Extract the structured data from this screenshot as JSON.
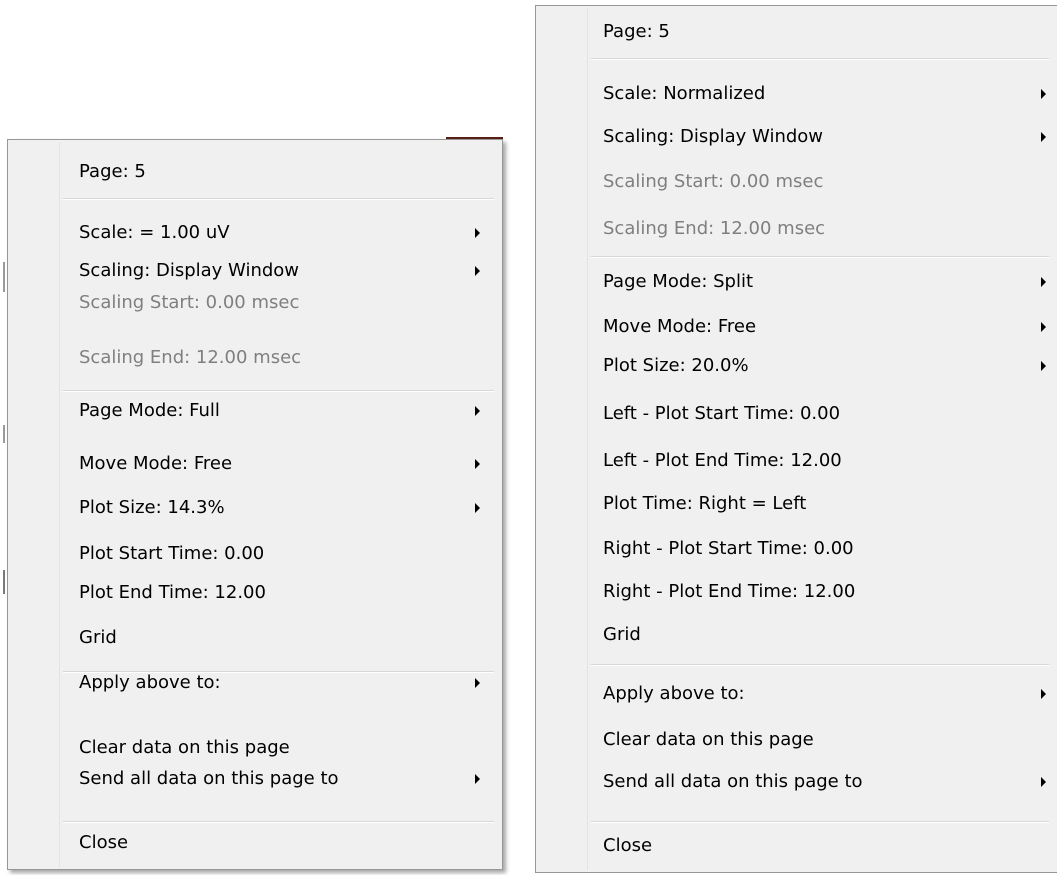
{
  "left_menu": {
    "items": [
      {
        "label": "Page: 5",
        "submenu": false,
        "disabled": false
      },
      {
        "label": "Scale: =  1.00 uV",
        "submenu": true,
        "disabled": false
      },
      {
        "label": "Scaling: Display Window",
        "submenu": true,
        "disabled": false
      },
      {
        "label": "Scaling Start:  0.00 msec",
        "submenu": false,
        "disabled": true
      },
      {
        "label": "Scaling End:  12.00 msec",
        "submenu": false,
        "disabled": true
      },
      {
        "label": "Page Mode: Full",
        "submenu": true,
        "disabled": false
      },
      {
        "label": "Move Mode: Free",
        "submenu": true,
        "disabled": false
      },
      {
        "label": "Plot Size: 14.3%",
        "submenu": true,
        "disabled": false
      },
      {
        "label": "Plot Start Time:  0.00",
        "submenu": false,
        "disabled": false
      },
      {
        "label": "Plot End Time: 12.00",
        "submenu": false,
        "disabled": false
      },
      {
        "label": "Grid",
        "submenu": false,
        "disabled": false
      },
      {
        "label": "Apply above to:",
        "submenu": true,
        "disabled": false
      },
      {
        "label": "Clear data on this page",
        "submenu": false,
        "disabled": false
      },
      {
        "label": "Send all data on this page to",
        "submenu": true,
        "disabled": false
      },
      {
        "label": "Close",
        "submenu": false,
        "disabled": false
      }
    ]
  },
  "right_menu": {
    "items": [
      {
        "label": "Page: 5",
        "submenu": false,
        "disabled": false
      },
      {
        "label": "Scale: Normalized",
        "submenu": true,
        "disabled": false
      },
      {
        "label": "Scaling: Display Window",
        "submenu": true,
        "disabled": false
      },
      {
        "label": "Scaling Start:  0.00 msec",
        "submenu": false,
        "disabled": true
      },
      {
        "label": "Scaling End:  12.00 msec",
        "submenu": false,
        "disabled": true
      },
      {
        "label": "Page Mode: Split",
        "submenu": true,
        "disabled": false
      },
      {
        "label": "Move Mode: Free",
        "submenu": true,
        "disabled": false
      },
      {
        "label": "Plot Size: 20.0%",
        "submenu": true,
        "disabled": false
      },
      {
        "label": "Left - Plot Start Time:  0.00",
        "submenu": false,
        "disabled": false
      },
      {
        "label": "Left - Plot End Time: 12.00",
        "submenu": false,
        "disabled": false
      },
      {
        "label": "Plot Time: Right = Left",
        "submenu": false,
        "disabled": false
      },
      {
        "label": "Right - Plot Start Time:  0.00",
        "submenu": false,
        "disabled": false
      },
      {
        "label": "Right - Plot End Time: 12.00",
        "submenu": false,
        "disabled": false
      },
      {
        "label": "Grid",
        "submenu": false,
        "disabled": false
      },
      {
        "label": "Apply above to:",
        "submenu": true,
        "disabled": false
      },
      {
        "label": "Clear data on this page",
        "submenu": false,
        "disabled": false
      },
      {
        "label": "Send all data on this page to",
        "submenu": true,
        "disabled": false
      },
      {
        "label": "Close",
        "submenu": false,
        "disabled": false
      }
    ]
  },
  "colors": {
    "menu_bg": "#f0f0f0",
    "text": "#000000",
    "disabled_text": "#7f7f7f",
    "border": "#979797"
  }
}
